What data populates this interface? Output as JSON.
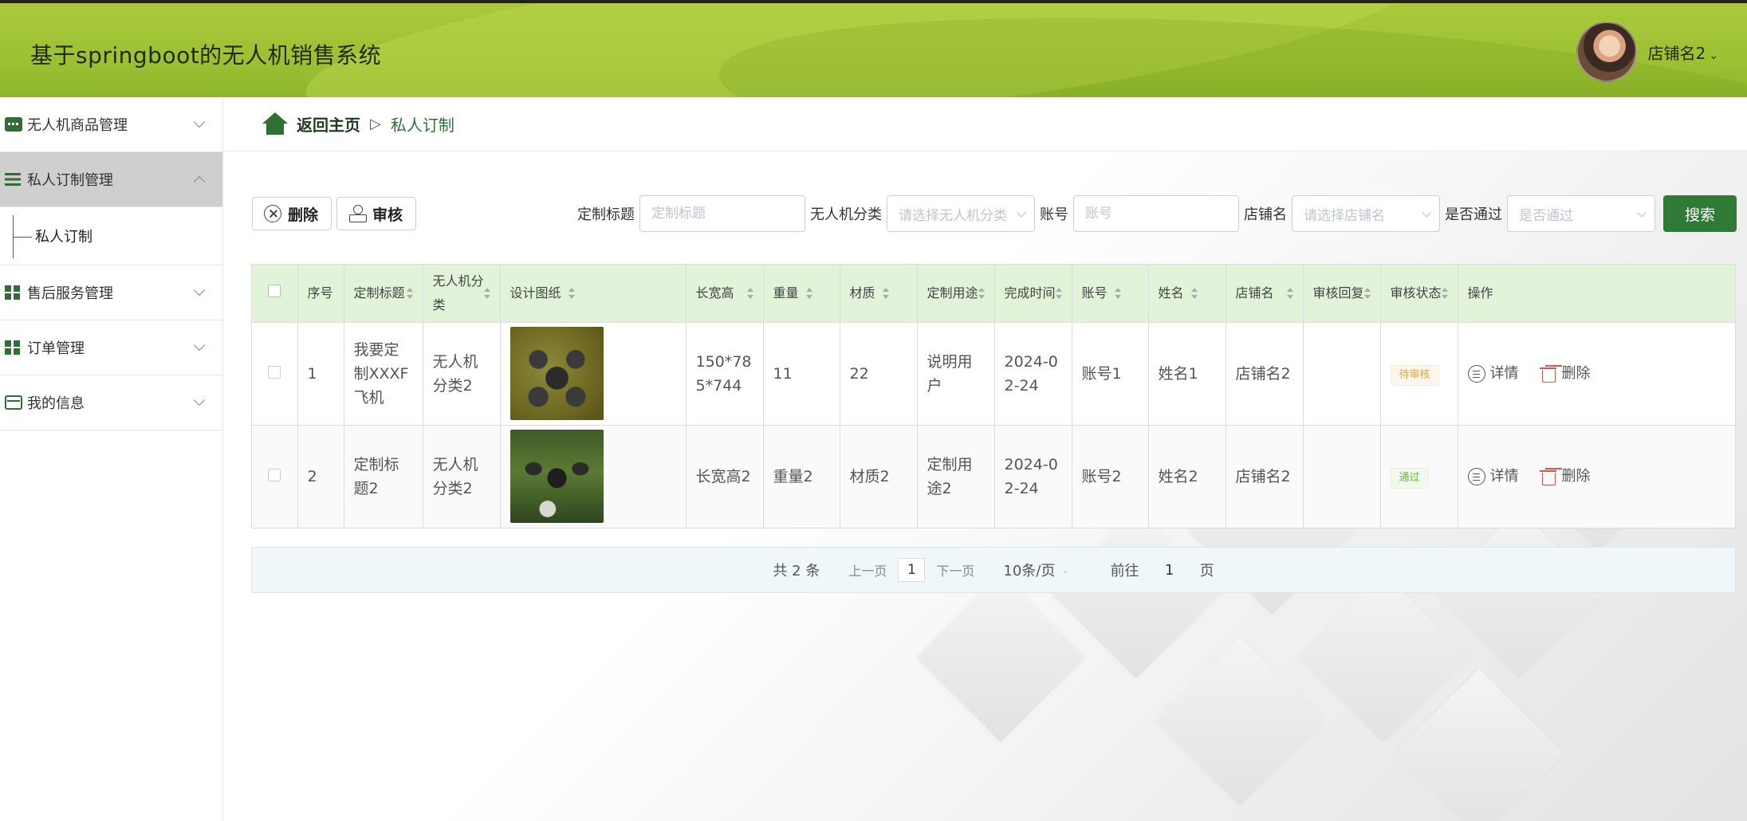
{
  "app": {
    "title": "基于springboot的无人机销售系统"
  },
  "user": {
    "name": "店铺名2"
  },
  "sidebar": {
    "items": [
      {
        "label": "无人机商品管理",
        "icon": "chat-icon"
      },
      {
        "label": "私人订制管理",
        "icon": "list-icon",
        "active": true,
        "children": [
          {
            "label": "私人订制"
          }
        ]
      },
      {
        "label": "售后服务管理",
        "icon": "grid-icon"
      },
      {
        "label": "订单管理",
        "icon": "grid-icon"
      },
      {
        "label": "我的信息",
        "icon": "card-icon"
      }
    ]
  },
  "breadcrumb": {
    "home": "返回主页",
    "separator": "▷",
    "current": "私人订制"
  },
  "toolbar": {
    "delete_label": "删除",
    "audit_label": "审核"
  },
  "filters": {
    "title": {
      "label": "定制标题",
      "placeholder": "定制标题"
    },
    "category": {
      "label": "无人机分类",
      "placeholder": "请选择无人机分类"
    },
    "account": {
      "label": "账号",
      "placeholder": "账号"
    },
    "shop": {
      "label": "店铺名",
      "placeholder": "请选择店铺名"
    },
    "passed": {
      "label": "是否通过",
      "placeholder": "是否通过"
    },
    "search_label": "搜索"
  },
  "table": {
    "headers": [
      "序号",
      "定制标题",
      "无人机分类",
      "设计图纸",
      "长宽高",
      "重量",
      "材质",
      "定制用途",
      "完成时间",
      "账号",
      "姓名",
      "店铺名",
      "审核回复",
      "审核状态",
      "操作"
    ],
    "rows": [
      {
        "index": "1",
        "title": "我要定制XXXF飞机",
        "category": "无人机分类2",
        "size": "150*785*744",
        "weight": "11",
        "material": "22",
        "usage": "说明用户",
        "finish": "2024-02-24",
        "account": "账号1",
        "name": "姓名1",
        "shop": "店铺名2",
        "reply": "",
        "status": "待审核"
      },
      {
        "index": "2",
        "title": "定制标题2",
        "category": "无人机分类2",
        "size": "长宽高2",
        "weight": "重量2",
        "material": "材质2",
        "usage": "定制用途2",
        "finish": "2024-02-24",
        "account": "账号2",
        "name": "姓名2",
        "shop": "店铺名2",
        "reply": "",
        "status": "通过"
      }
    ],
    "actions": {
      "detail": "详情",
      "delete": "删除"
    }
  },
  "pagination": {
    "total": "共 2 条",
    "prev": "上一页",
    "page": "1",
    "next": "下一页",
    "page_size": "10条/页",
    "goto_prefix": "前往",
    "goto_value": "1",
    "goto_suffix": "页"
  },
  "colors": {
    "header_green": "#9dc133",
    "brand_green": "#2e7a36",
    "table_head": "#e1f3d8"
  }
}
